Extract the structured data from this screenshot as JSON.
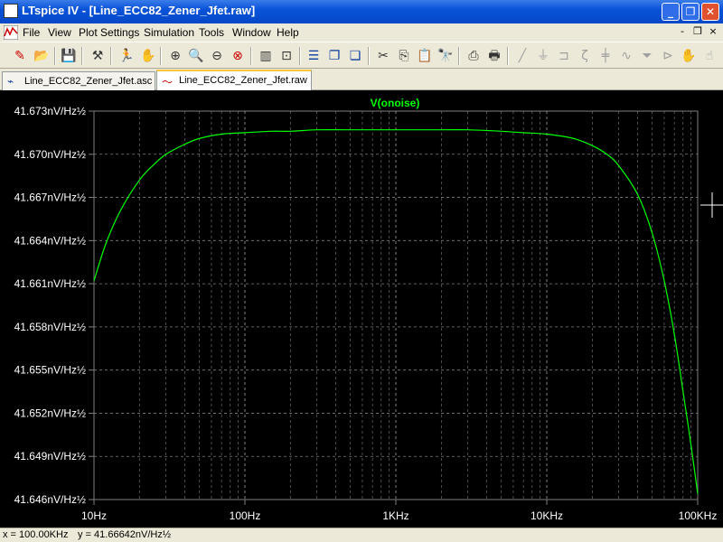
{
  "window": {
    "title": "LTspice IV - [Line_ECC82_Zener_Jfet.raw]",
    "minimize": "_",
    "restore": "❐",
    "close": "✕"
  },
  "menu": {
    "items": [
      "File",
      "View",
      "Plot Settings",
      "Simulation",
      "Tools",
      "Window",
      "Help"
    ],
    "mdi_min": "-",
    "mdi_restore": "❐",
    "mdi_close": "×"
  },
  "toolbar": {
    "buttons": [
      "open-schematic",
      "open-file",
      "save",
      "control-panel",
      "run",
      "halt",
      "zoom-in",
      "zoom-pan",
      "zoom-out",
      "zoom-cancel",
      "autoscale",
      "zoom-box",
      "tile-horizontal",
      "cascade",
      "tile-vertical",
      "cut",
      "copy",
      "paste",
      "find",
      "print-preview",
      "print",
      "wire",
      "ground",
      "label",
      "resistor",
      "capacitor",
      "inductor",
      "diode",
      "component",
      "move",
      "drag"
    ]
  },
  "tabs": [
    {
      "label": "Line_ECC82_Zener_Jfet.asc",
      "icon": "schematic-icon",
      "active": false
    },
    {
      "label": "Line_ECC82_Zener_Jfet.raw",
      "icon": "waveform-icon",
      "active": true
    }
  ],
  "chart_data": {
    "type": "line",
    "title": "V(onoise)",
    "xscale": "log",
    "xlim": [
      10,
      100000
    ],
    "ylim": [
      41.646,
      41.673
    ],
    "y_ticks": [
      "41.673nV/Hz½",
      "41.670nV/Hz½",
      "41.667nV/Hz½",
      "41.664nV/Hz½",
      "41.661nV/Hz½",
      "41.658nV/Hz½",
      "41.655nV/Hz½",
      "41.652nV/Hz½",
      "41.649nV/Hz½",
      "41.646nV/Hz½"
    ],
    "x_ticks": [
      "10Hz",
      "100Hz",
      "1KHz",
      "10KHz",
      "100KHz"
    ],
    "grid": true,
    "colors": {
      "background": "#000000",
      "trace": "#00ff00",
      "grid": "#808080",
      "text": "#ffffff",
      "title": "#00ff00"
    },
    "series": [
      {
        "name": "V(onoise)",
        "x": [
          10,
          12,
          15,
          20,
          25,
          30,
          40,
          50,
          70,
          100,
          150,
          200,
          300,
          500,
          1000,
          2000,
          3000,
          5000,
          7000,
          10000,
          15000,
          20000,
          25000,
          30000,
          40000,
          50000,
          60000,
          70000,
          80000,
          90000,
          100000
        ],
        "y": [
          41.6612,
          41.6638,
          41.6661,
          41.6682,
          41.6693,
          41.67,
          41.6707,
          41.6711,
          41.6714,
          41.6715,
          41.6716,
          41.6716,
          41.6717,
          41.6717,
          41.6717,
          41.6717,
          41.6717,
          41.6716,
          41.6715,
          41.6714,
          41.6711,
          41.6706,
          41.67,
          41.6692,
          41.6672,
          41.6645,
          41.6612,
          41.6575,
          41.6535,
          41.6499,
          41.6464
        ]
      }
    ]
  },
  "cursor": {
    "x": 100000,
    "y": 41.66642
  },
  "status": {
    "x_text": "x = 100.00KHz",
    "y_text": "y = 41.66642nV/Hz½"
  }
}
